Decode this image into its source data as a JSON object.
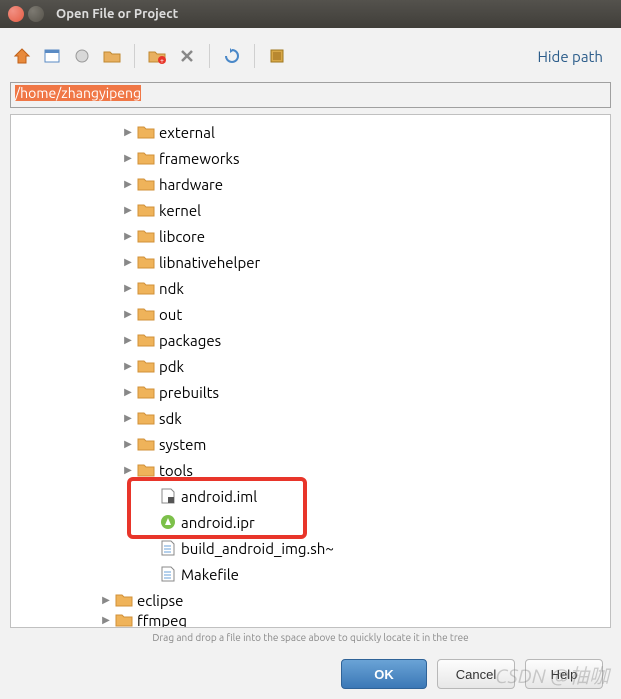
{
  "window": {
    "title": "Open File or Project"
  },
  "toolbar": {
    "hide_path": "Hide path",
    "icons": [
      "home",
      "file",
      "light",
      "new-folder",
      "new-folder-plus",
      "delete",
      "refresh",
      "module"
    ]
  },
  "path_input": "/home/zhangyipeng",
  "tree": {
    "indent_base": 110,
    "items": [
      {
        "type": "folder",
        "label": "external",
        "depth": 0
      },
      {
        "type": "folder",
        "label": "frameworks",
        "depth": 0
      },
      {
        "type": "folder",
        "label": "hardware",
        "depth": 0
      },
      {
        "type": "folder",
        "label": "kernel",
        "depth": 0
      },
      {
        "type": "folder",
        "label": "libcore",
        "depth": 0
      },
      {
        "type": "folder",
        "label": "libnativehelper",
        "depth": 0
      },
      {
        "type": "folder",
        "label": "ndk",
        "depth": 0
      },
      {
        "type": "folder",
        "label": "out",
        "depth": 0
      },
      {
        "type": "folder",
        "label": "packages",
        "depth": 0
      },
      {
        "type": "folder",
        "label": "pdk",
        "depth": 0
      },
      {
        "type": "folder",
        "label": "prebuilts",
        "depth": 0
      },
      {
        "type": "folder",
        "label": "sdk",
        "depth": 0
      },
      {
        "type": "folder",
        "label": "system",
        "depth": 0
      },
      {
        "type": "folder",
        "label": "tools",
        "depth": 0
      },
      {
        "type": "file",
        "icon": "iml",
        "label": "android.iml",
        "depth": 1,
        "boxed": true
      },
      {
        "type": "file",
        "icon": "ipr",
        "label": "android.ipr",
        "depth": 1,
        "boxed": true
      },
      {
        "type": "file",
        "icon": "txt",
        "label": "build_android_img.sh~",
        "depth": 1
      },
      {
        "type": "file",
        "icon": "txt",
        "label": "Makefile",
        "depth": 1
      },
      {
        "type": "folder",
        "label": "eclipse",
        "depth": -1
      },
      {
        "type": "folder",
        "label": "ffmpeg",
        "depth": -1,
        "cut": true
      }
    ]
  },
  "hint": "Drag and drop a file into the space above to quickly locate it in the tree",
  "buttons": {
    "ok": "OK",
    "cancel": "Cancel",
    "help": "Help"
  },
  "watermark": "CSDN @柚咖"
}
